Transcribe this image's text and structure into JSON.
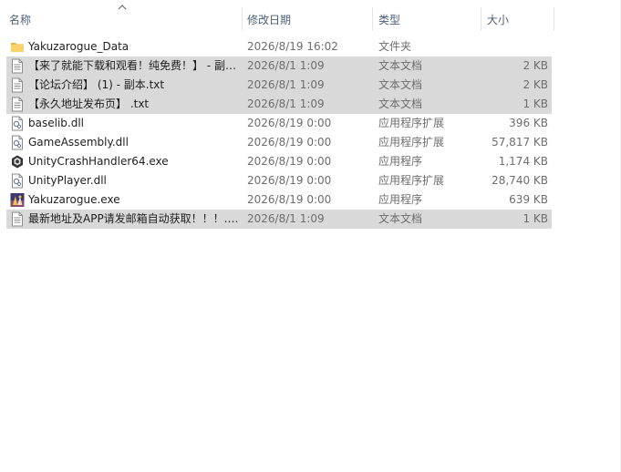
{
  "columns": {
    "name": "名称",
    "date": "修改日期",
    "type": "类型",
    "size": "大小"
  },
  "files": [
    {
      "name": "Yakuzarogue_Data",
      "date": "2026/8/19 16:02",
      "type": "文件夹",
      "size": "",
      "icon": "folder-icon",
      "selected": false
    },
    {
      "name": "【来了就能下载和观看！纯免费！】 - 副本.txt",
      "date": "2026/8/1 1:09",
      "type": "文本文档",
      "size": "2 KB",
      "icon": "text-document-icon",
      "selected": true
    },
    {
      "name": "【论坛介绍】 (1) - 副本.txt",
      "date": "2026/8/1 1:09",
      "type": "文本文档",
      "size": "2 KB",
      "icon": "text-document-icon",
      "selected": true
    },
    {
      "name": "【永久地址发布页】 .txt",
      "date": "2026/8/1 1:09",
      "type": "文本文档",
      "size": "1 KB",
      "icon": "text-document-icon",
      "selected": true
    },
    {
      "name": "baselib.dll",
      "date": "2026/8/19 0:00",
      "type": "应用程序扩展",
      "size": "396 KB",
      "icon": "dll-icon",
      "selected": false
    },
    {
      "name": "GameAssembly.dll",
      "date": "2026/8/19 0:00",
      "type": "应用程序扩展",
      "size": "57,817 KB",
      "icon": "dll-icon",
      "selected": false
    },
    {
      "name": "UnityCrashHandler64.exe",
      "date": "2026/8/19 0:00",
      "type": "应用程序",
      "size": "1,174 KB",
      "icon": "unity-icon",
      "selected": false
    },
    {
      "name": "UnityPlayer.dll",
      "date": "2026/8/19 0:00",
      "type": "应用程序扩展",
      "size": "28,740 KB",
      "icon": "dll-icon",
      "selected": false
    },
    {
      "name": "Yakuzarogue.exe",
      "date": "2026/8/19 0:00",
      "type": "应用程序",
      "size": "639 KB",
      "icon": "game-exe-icon",
      "selected": false
    },
    {
      "name": "最新地址及APP请发邮箱自动获取！！！.txt",
      "date": "2026/8/1 1:09",
      "type": "文本文档",
      "size": "1 KB",
      "icon": "text-document-icon",
      "selected": true
    }
  ]
}
